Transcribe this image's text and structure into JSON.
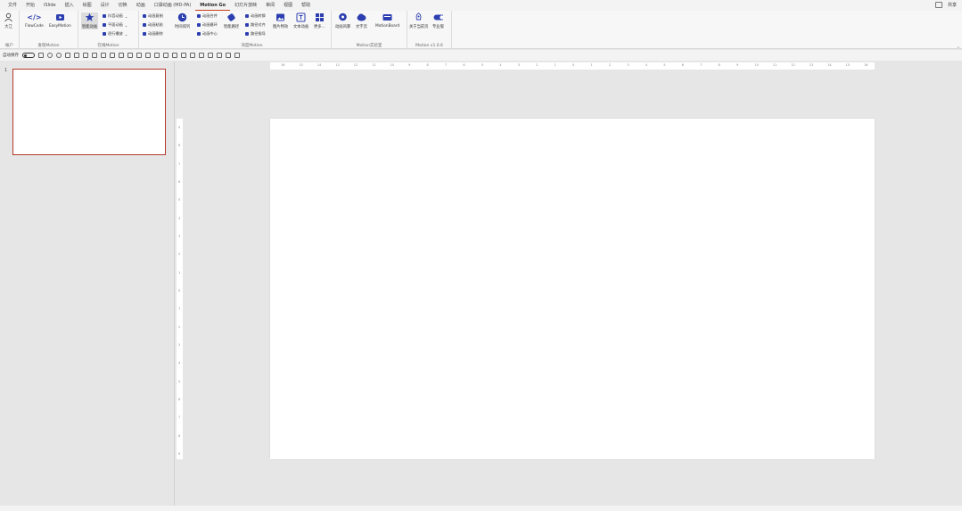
{
  "menu": {
    "tabs": [
      "文件",
      "开始",
      "iSlide",
      "插入",
      "绘图",
      "设计",
      "切换",
      "动画",
      "口袋动画 (MD-PA)",
      "Motion Go",
      "幻灯片放映",
      "审阅",
      "视图",
      "帮助"
    ],
    "active_index": 9,
    "right_share": "共享"
  },
  "ribbon": {
    "account": {
      "btn": "大江",
      "group": "帐户"
    },
    "explore": {
      "flowcode": "FlowCode",
      "easymotion": "EasyMotion",
      "group": "发现Motion"
    },
    "online": {
      "smart": "智能动画",
      "items": [
        "抖音动画",
        "平面动画",
        "逐行播放"
      ],
      "group": "在线Motion"
    },
    "anim": {
      "items": [
        "动画复制",
        "动画粘贴",
        "动画删除"
      ]
    },
    "deep": {
      "timeline": "时间排列",
      "items": [
        "动画合并",
        "动画循环",
        "动画中心"
      ],
      "items2": [
        "动画转换",
        "路径对齐",
        "路径指导"
      ],
      "smart_path": "智能路径",
      "image": "图片特效",
      "text": "文本动画",
      "more": "更多...",
      "group": "深度Motion"
    },
    "lab": {
      "style": "动画风暴",
      "textlab": "文字云",
      "board": "MotionBoard",
      "group": "Motion实验室"
    },
    "about": {
      "about": "关于当前页",
      "pro": "专业版",
      "group": "Motion v1.0.6"
    }
  },
  "qat": {
    "autosave": "自动保存"
  },
  "slides": {
    "thumb_number": "1"
  },
  "ruler": {
    "h_ticks": [
      "16",
      "15",
      "14",
      "13",
      "12",
      "11",
      "10",
      "9",
      "8",
      "7",
      "6",
      "5",
      "4",
      "3",
      "2",
      "1",
      "0",
      "1",
      "2",
      "3",
      "4",
      "5",
      "6",
      "7",
      "8",
      "9",
      "10",
      "11",
      "12",
      "13",
      "14",
      "15",
      "16"
    ],
    "v_ticks": [
      "9",
      "8",
      "7",
      "6",
      "5",
      "4",
      "3",
      "2",
      "1",
      "0",
      "1",
      "2",
      "3",
      "4",
      "5",
      "6",
      "7",
      "8",
      "9"
    ]
  },
  "colors": {
    "accent": "#c43e1c",
    "icon_blue": "#2d3fb0",
    "thumb_border": "#b5392c"
  }
}
